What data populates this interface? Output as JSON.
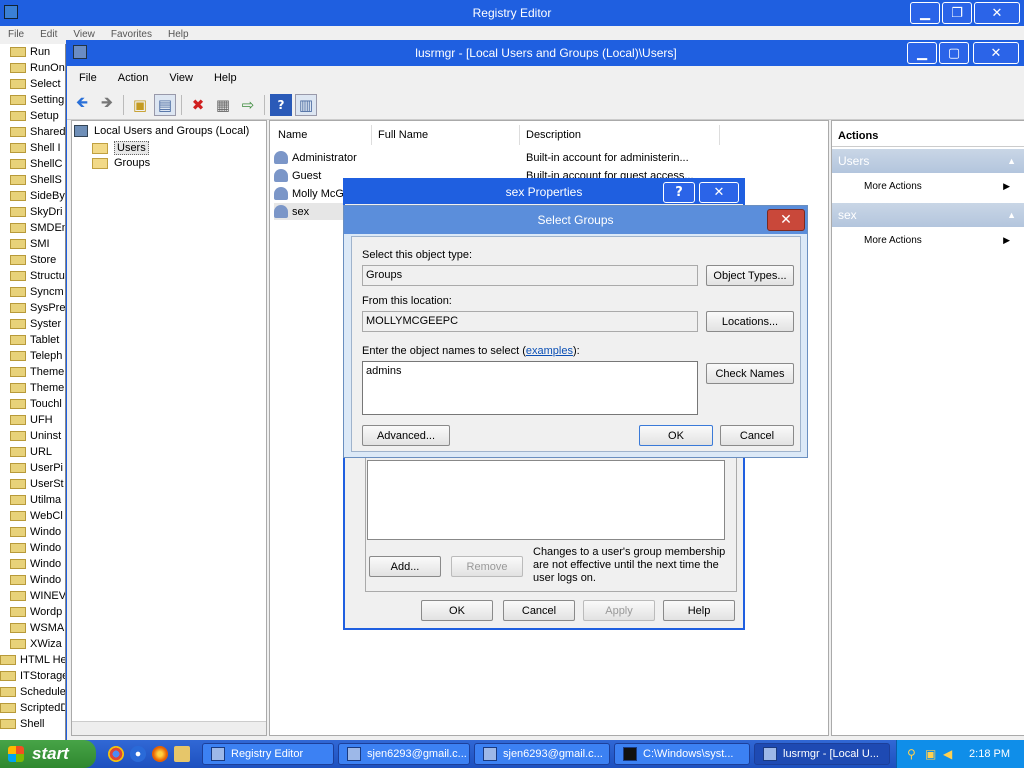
{
  "registry_editor": {
    "title": "Registry Editor",
    "menu": [
      "File",
      "Edit",
      "View",
      "Favorites",
      "Help"
    ],
    "tree_items": [
      "Run",
      "RunOn",
      "Select",
      "Setting",
      "Setup",
      "Shared",
      "Shell I",
      "ShellC",
      "ShellS",
      "SideBy",
      "SkyDri",
      "SMDEn",
      "SMI",
      "Store",
      "Structu",
      "Syncm",
      "SysPre",
      "Syster",
      "Tablet",
      "Teleph",
      "Theme",
      "Theme",
      "Touchl",
      "UFH",
      "Uninst",
      "URL",
      "UserPi",
      "UserSt",
      "Utilma",
      "WebCl",
      "Windo",
      "Windo",
      "Windo",
      "Windo",
      "WINEV",
      "Wordp",
      "WSMA",
      "XWiza"
    ],
    "root_items": [
      "HTML Hel",
      "ITStorage",
      "Scheduled",
      "ScriptedD",
      "Shell"
    ]
  },
  "lusrmgr": {
    "title": "lusrmgr - [Local Users and Groups (Local)\\Users]",
    "menu": [
      "File",
      "Action",
      "View",
      "Help"
    ],
    "tree": {
      "root": "Local Users and Groups (Local)",
      "users": "Users",
      "groups": "Groups"
    },
    "columns": [
      "Name",
      "Full Name",
      "Description"
    ],
    "rows": [
      {
        "name": "Administrator",
        "description": "Built-in account for administerin..."
      },
      {
        "name": "Guest",
        "description": "Built-in account for guest access..."
      },
      {
        "name": "Molly McG",
        "description": ""
      },
      {
        "name": "sex",
        "description": ""
      }
    ],
    "actions": {
      "header": "Actions",
      "section1": "Users",
      "section1_item": "More Actions",
      "section2": "sex",
      "section2_item": "More Actions"
    }
  },
  "properties_dialog": {
    "title": "sex Properties",
    "help_glyph": "?",
    "add_label": "Add...",
    "remove_label": "Remove",
    "note": "Changes to a user's group membership are not effective until the next time the user logs on.",
    "ok_label": "OK",
    "cancel_label": "Cancel",
    "apply_label": "Apply",
    "help_label": "Help"
  },
  "select_groups": {
    "title": "Select Groups",
    "object_type_label": "Select this object type:",
    "object_type_value": "Groups",
    "object_types_button": "Object Types...",
    "location_label": "From this location:",
    "location_value": "MOLLYMCGEEPC",
    "locations_button": "Locations...",
    "names_label_prefix": "Enter the object names to select (",
    "names_label_link": "examples",
    "names_label_suffix": "):",
    "names_value": "admins",
    "check_names_button": "Check Names",
    "advanced_button": "Advanced...",
    "ok_button": "OK",
    "cancel_button": "Cancel"
  },
  "taskbar": {
    "start_label": "start",
    "tasks": [
      "Registry Editor",
      "sjen6293@gmail.c...",
      "sjen6293@gmail.c...",
      "C:\\Windows\\syst...",
      "lusrmgr - [Local U..."
    ],
    "clock": "2:18 PM"
  },
  "colors": {
    "title_blue": "#1f5fe0",
    "start_green": "#3a9a3a",
    "close_red": "#c9483a"
  }
}
